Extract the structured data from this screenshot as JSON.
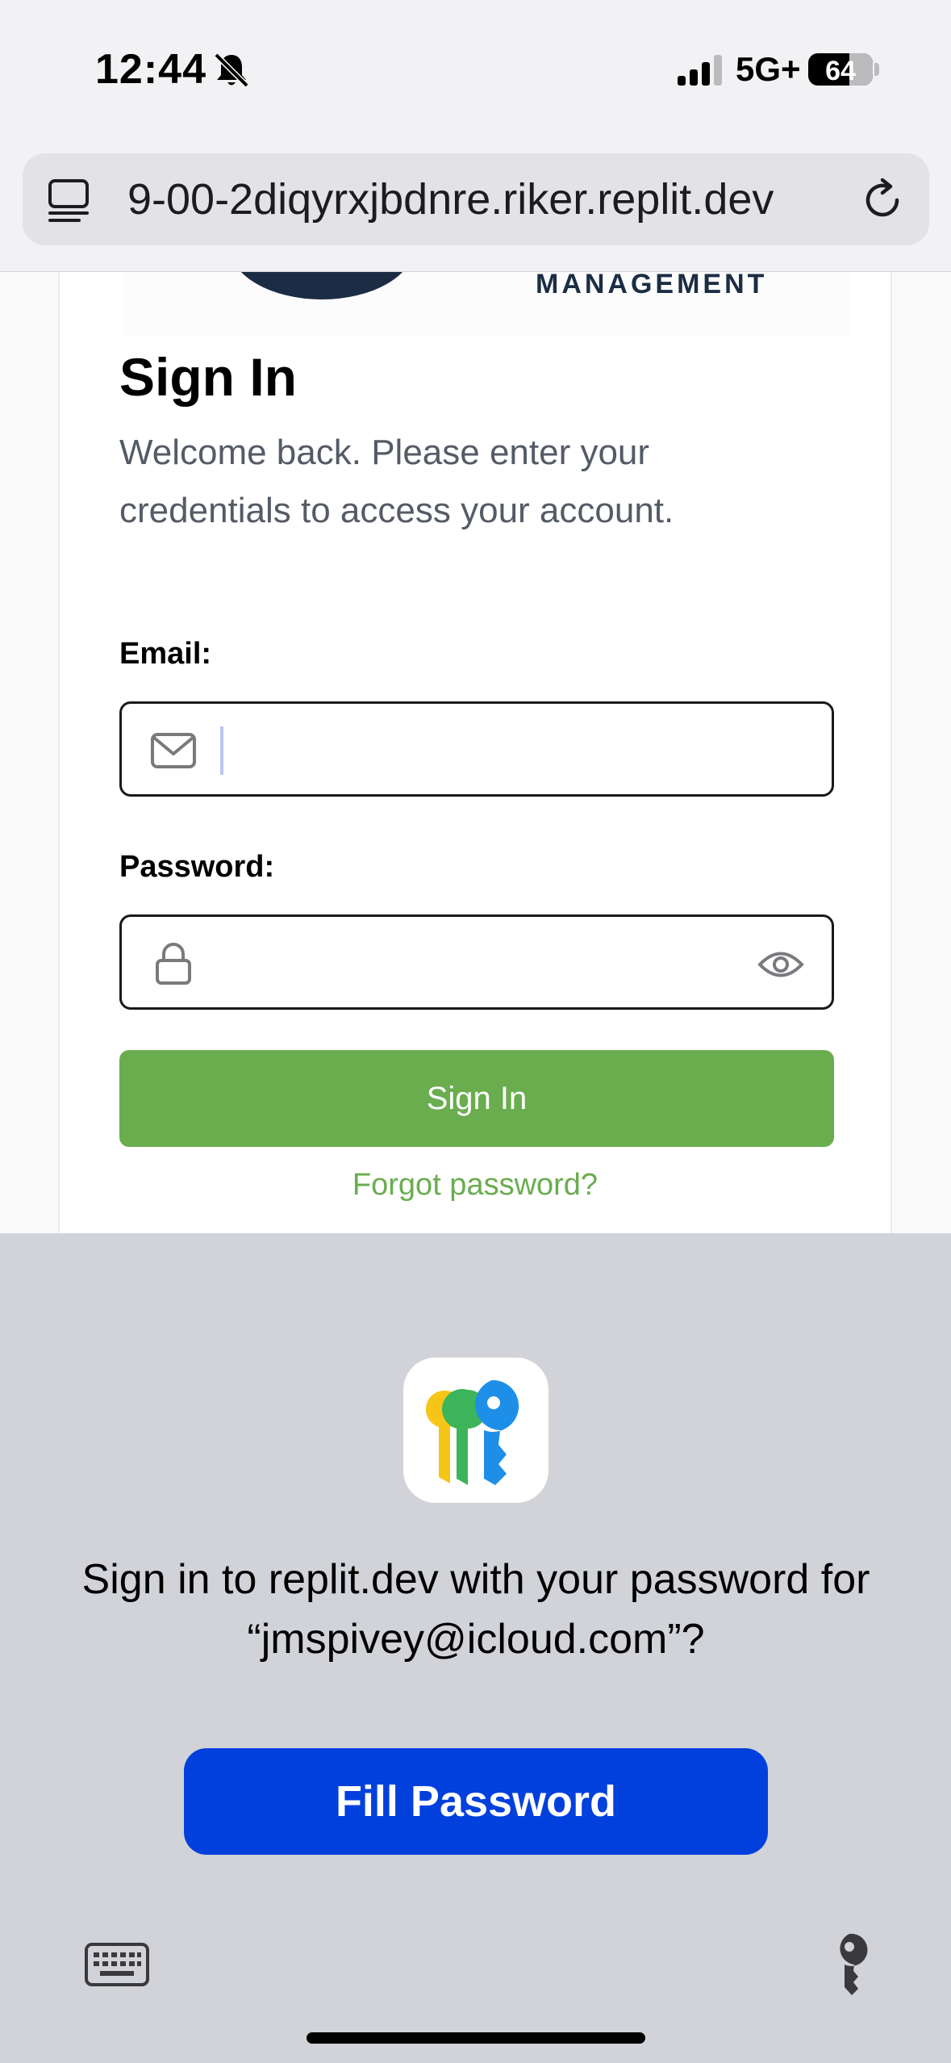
{
  "status_bar": {
    "time": "12:44",
    "network": "5G+",
    "battery": "64",
    "battery_level": 0.64
  },
  "browser": {
    "url": "9-00-2diqyrxjbdnre.riker.replit.dev"
  },
  "page": {
    "logo_text": "MANAGEMENT",
    "title": "Sign In",
    "subtitle": "Welcome back. Please enter your credentials to access your account.",
    "email_label": "Email:",
    "password_label": "Password:",
    "sign_in_button": "Sign In",
    "forgot_link": "Forgot password?"
  },
  "password_prompt": {
    "message": "Sign in to replit.dev with your password for “jmspivey@icloud.com”?",
    "fill_button": "Fill Password"
  },
  "colors": {
    "accent_green": "#6aad4f",
    "fill_blue": "#0140dd"
  }
}
